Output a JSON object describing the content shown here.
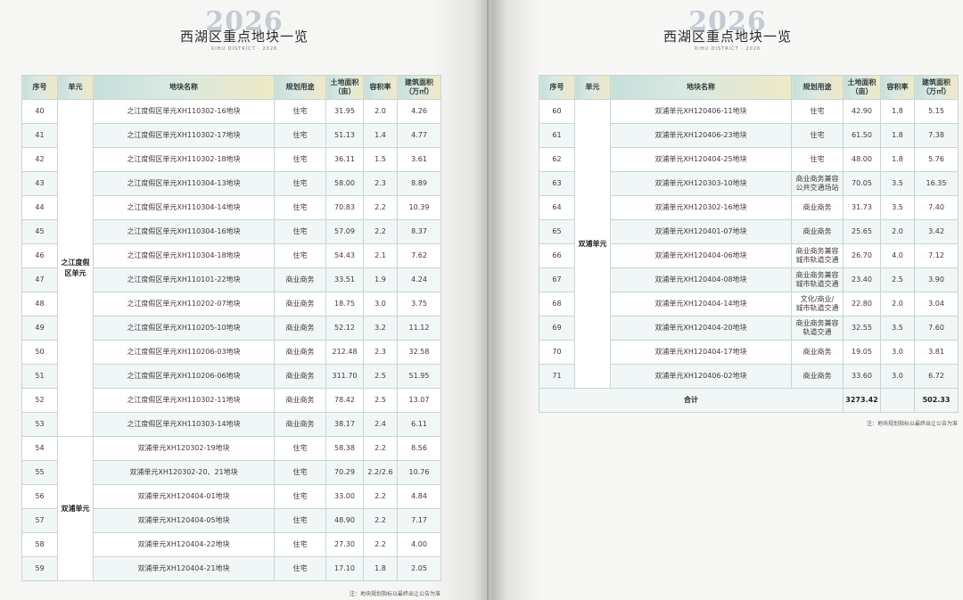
{
  "header": {
    "year": "2026",
    "title": "西湖区重点地块一览",
    "subtitle": "XIHU DISTRICT · 2026"
  },
  "columns": [
    "序号",
    "单元",
    "地块名称",
    "规划用途",
    "土地面积\n（亩）",
    "容积率",
    "建筑面积\n（万㎡）"
  ],
  "left_table": {
    "groups": [
      {
        "unit": "之江度假\n区单元",
        "rows": [
          {
            "no": "40",
            "name": "之江度假区单元XH110302-16地块",
            "use": "住宅",
            "area": "31.95",
            "far": "2.0",
            "gfa": "4.26"
          },
          {
            "no": "41",
            "name": "之江度假区单元XH110302-17地块",
            "use": "住宅",
            "area": "51.13",
            "far": "1.4",
            "gfa": "4.77"
          },
          {
            "no": "42",
            "name": "之江度假区单元XH110302-18地块",
            "use": "住宅",
            "area": "36.11",
            "far": "1.5",
            "gfa": "3.61"
          },
          {
            "no": "43",
            "name": "之江度假区单元XH110304-13地块",
            "use": "住宅",
            "area": "58.00",
            "far": "2.3",
            "gfa": "8.89"
          },
          {
            "no": "44",
            "name": "之江度假区单元XH110304-14地块",
            "use": "住宅",
            "area": "70.83",
            "far": "2.2",
            "gfa": "10.39"
          },
          {
            "no": "45",
            "name": "之江度假区单元XH110304-16地块",
            "use": "住宅",
            "area": "57.09",
            "far": "2.2",
            "gfa": "8.37"
          },
          {
            "no": "46",
            "name": "之江度假区单元XH110304-18地块",
            "use": "住宅",
            "area": "54.43",
            "far": "2.1",
            "gfa": "7.62"
          },
          {
            "no": "47",
            "name": "之江度假区单元XH110101-22地块",
            "use": "商业商务",
            "area": "33.51",
            "far": "1.9",
            "gfa": "4.24"
          },
          {
            "no": "48",
            "name": "之江度假区单元XH110202-07地块",
            "use": "商业商务",
            "area": "18.75",
            "far": "3.0",
            "gfa": "3.75"
          },
          {
            "no": "49",
            "name": "之江度假区单元XH110205-10地块",
            "use": "商业商务",
            "area": "52.12",
            "far": "3.2",
            "gfa": "11.12"
          },
          {
            "no": "50",
            "name": "之江度假区单元XH110206-03地块",
            "use": "商业商务",
            "area": "212.48",
            "far": "2.3",
            "gfa": "32.58"
          },
          {
            "no": "51",
            "name": "之江度假区单元XH110206-06地块",
            "use": "商业商务",
            "area": "311.70",
            "far": "2.5",
            "gfa": "51.95"
          },
          {
            "no": "52",
            "name": "之江度假区单元XH110302-11地块",
            "use": "商业商务",
            "area": "78.42",
            "far": "2.5",
            "gfa": "13.07"
          },
          {
            "no": "53",
            "name": "之江度假区单元XH110303-14地块",
            "use": "商业商务",
            "area": "38.17",
            "far": "2.4",
            "gfa": "6.11"
          }
        ]
      },
      {
        "unit": "双浦单元",
        "rows": [
          {
            "no": "54",
            "name": "双浦单元XH120302-19地块",
            "use": "住宅",
            "area": "58.38",
            "far": "2.2",
            "gfa": "8.56"
          },
          {
            "no": "55",
            "name": "双浦单元XH120302-20、21地块",
            "use": "住宅",
            "area": "70.29",
            "far": "2.2/2.6",
            "gfa": "10.76"
          },
          {
            "no": "56",
            "name": "双浦单元XH120404-01地块",
            "use": "住宅",
            "area": "33.00",
            "far": "2.2",
            "gfa": "4.84"
          },
          {
            "no": "57",
            "name": "双浦单元XH120404-05地块",
            "use": "住宅",
            "area": "48.90",
            "far": "2.2",
            "gfa": "7.17"
          },
          {
            "no": "58",
            "name": "双浦单元XH120404-22地块",
            "use": "住宅",
            "area": "27.30",
            "far": "2.2",
            "gfa": "4.00"
          },
          {
            "no": "59",
            "name": "双浦单元XH120404-21地块",
            "use": "住宅",
            "area": "17.10",
            "far": "1.8",
            "gfa": "2.05"
          }
        ]
      }
    ]
  },
  "right_table": {
    "groups": [
      {
        "unit": "双浦单元",
        "rows": [
          {
            "no": "60",
            "name": "双浦单元XH120406-11地块",
            "use": "住宅",
            "area": "42.90",
            "far": "1.8",
            "gfa": "5.15"
          },
          {
            "no": "61",
            "name": "双浦单元XH120406-23地块",
            "use": "住宅",
            "area": "61.50",
            "far": "1.8",
            "gfa": "7.38"
          },
          {
            "no": "62",
            "name": "双浦单元XH120404-25地块",
            "use": "住宅",
            "area": "48.00",
            "far": "1.8",
            "gfa": "5.76"
          },
          {
            "no": "63",
            "name": "双浦单元XH120303-10地块",
            "use": "商业商务兼容\n公共交通场站",
            "area": "70.05",
            "far": "3.5",
            "gfa": "16.35"
          },
          {
            "no": "64",
            "name": "双浦单元XH120302-16地块",
            "use": "商业商务",
            "area": "31.73",
            "far": "3.5",
            "gfa": "7.40"
          },
          {
            "no": "65",
            "name": "双浦单元XH120401-07地块",
            "use": "商业商务",
            "area": "25.65",
            "far": "2.0",
            "gfa": "3.42"
          },
          {
            "no": "66",
            "name": "双浦单元XH120404-06地块",
            "use": "商业商务兼容\n城市轨道交通",
            "area": "26.70",
            "far": "4.0",
            "gfa": "7.12"
          },
          {
            "no": "67",
            "name": "双浦单元XH120404-08地块",
            "use": "商业商务兼容\n城市轨道交通",
            "area": "23.40",
            "far": "2.5",
            "gfa": "3.90"
          },
          {
            "no": "68",
            "name": "双浦单元XH120404-14地块",
            "use": "文化/商业/\n城市轨道交通",
            "area": "22.80",
            "far": "2.0",
            "gfa": "3.04"
          },
          {
            "no": "69",
            "name": "双浦单元XH120404-20地块",
            "use": "商业商务兼容\n轨道交通",
            "area": "32.55",
            "far": "3.5",
            "gfa": "7.60"
          },
          {
            "no": "70",
            "name": "双浦单元XH120404-17地块",
            "use": "商业商务",
            "area": "19.05",
            "far": "3.0",
            "gfa": "3.81"
          },
          {
            "no": "71",
            "name": "双浦单元XH120406-02地块",
            "use": "商业商务",
            "area": "33.60",
            "far": "3.0",
            "gfa": "6.72"
          }
        ]
      }
    ],
    "total": {
      "label": "合计",
      "area": "3273.42",
      "gfa": "502.33"
    }
  },
  "note": "注：地块规划指标以最终出让公告为准"
}
